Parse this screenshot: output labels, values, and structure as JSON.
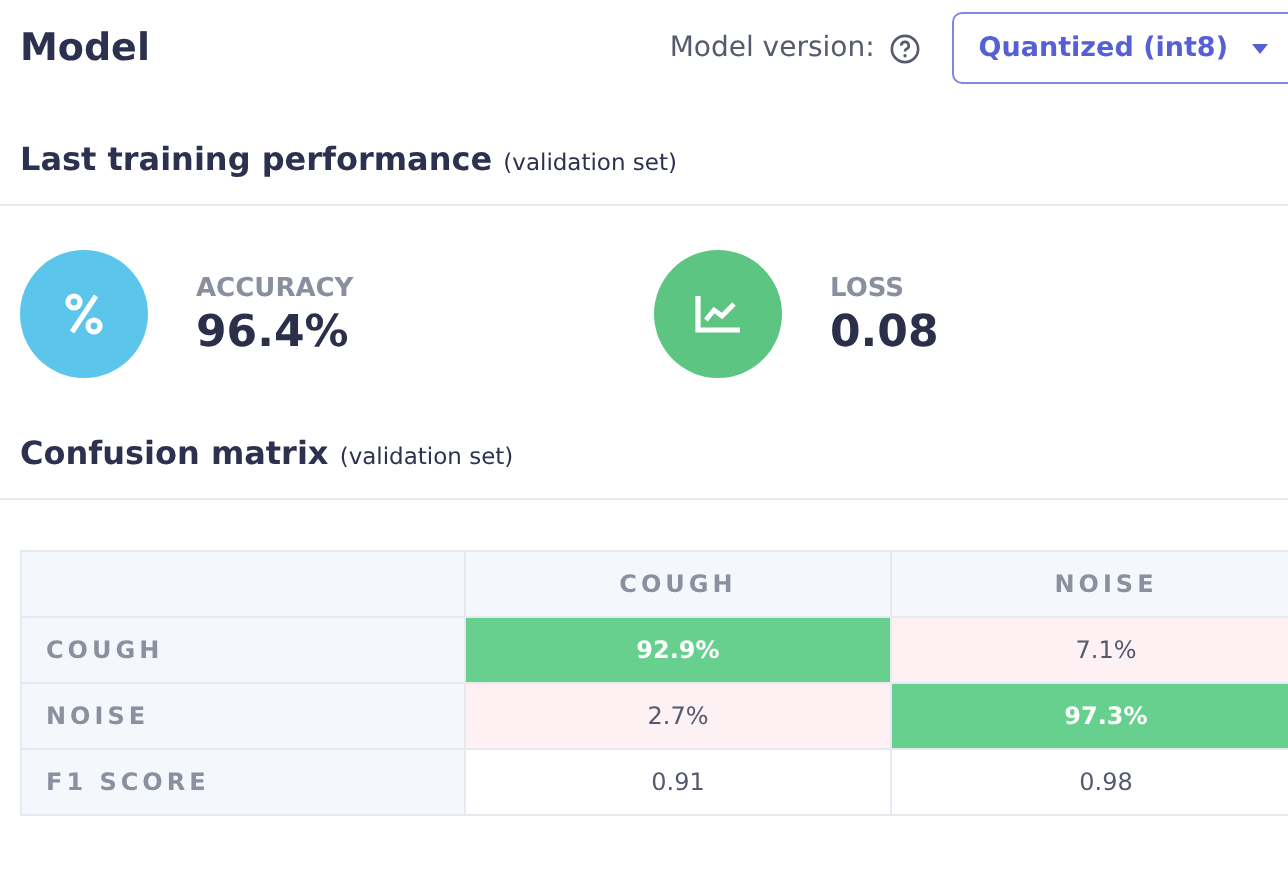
{
  "title": "Model",
  "version": {
    "label": "Model version:",
    "value": "Quantized (int8)"
  },
  "performance": {
    "heading": "Last training performance",
    "note": "(validation set)",
    "metrics": [
      {
        "kind": "percent",
        "color": "#5bc5eb",
        "label": "ACCURACY",
        "value": "96.4%"
      },
      {
        "kind": "chart",
        "color": "#5dc582",
        "label": "LOSS",
        "value": "0.08"
      }
    ]
  },
  "confusion": {
    "heading": "Confusion matrix",
    "note": "(validation set)",
    "columns": [
      "COUGH",
      "NOISE"
    ],
    "rows": [
      {
        "label": "COUGH",
        "cells": [
          {
            "text": "92.9%",
            "correct": true
          },
          {
            "text": "7.1%",
            "correct": false
          }
        ]
      },
      {
        "label": "NOISE",
        "cells": [
          {
            "text": "2.7%",
            "correct": false
          },
          {
            "text": "97.3%",
            "correct": true
          }
        ]
      }
    ],
    "f1": {
      "label": "F1 SCORE",
      "values": [
        "0.91",
        "0.98"
      ]
    }
  }
}
